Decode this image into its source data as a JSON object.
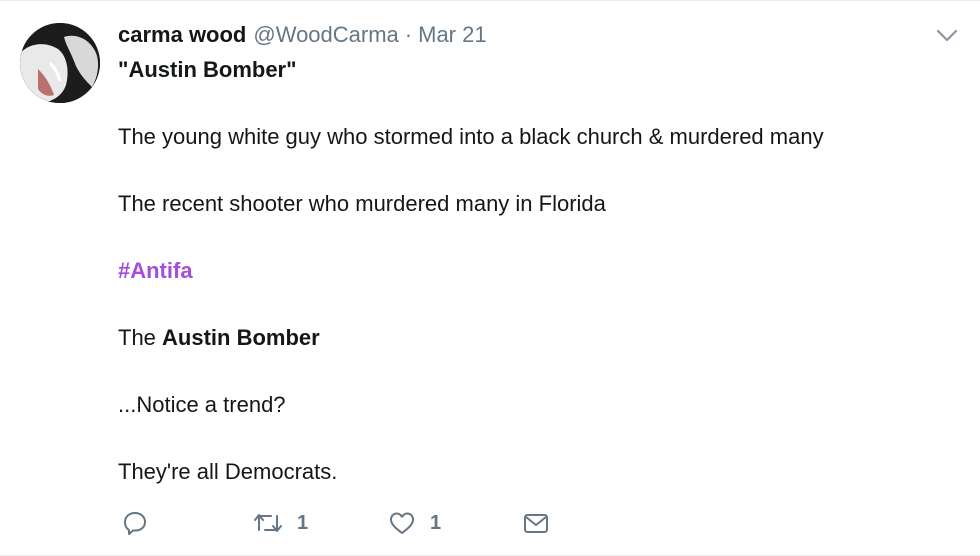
{
  "tweet": {
    "author": {
      "name": "carma wood",
      "handle": "@WoodCarma",
      "separator": "·",
      "date": "Mar 21",
      "avatar_icon": "avatar-photo"
    },
    "lines": {
      "l1_open_quote": "\"",
      "l1_bold": "Austin Bomber",
      "l1_close_quote": "\"",
      "l2": "The young white guy who stormed into a black church & murdered many",
      "l3": "The recent shooter who murdered many in Florida",
      "l4_hashtag": "#Antifa",
      "l5_prefix": "The ",
      "l5_bold": "Austin Bomber",
      "l6": "...Notice a trend?",
      "l7": "They're all Democrats."
    },
    "hashtag_color": "#a34fd8",
    "actions": {
      "reply_icon": "reply-icon",
      "retweet_icon": "retweet-icon",
      "retweet_count": "1",
      "like_icon": "heart-icon",
      "like_count": "1",
      "message_icon": "envelope-icon"
    },
    "menu_icon": "chevron-down-icon"
  }
}
